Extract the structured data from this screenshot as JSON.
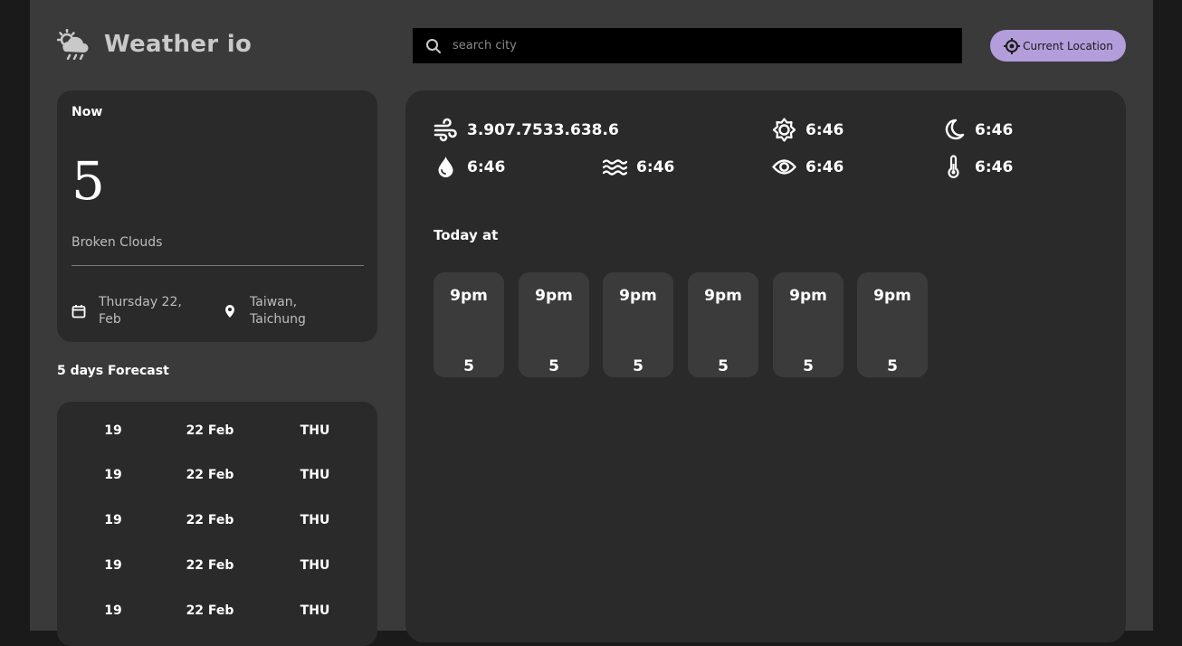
{
  "header": {
    "app_name": "Weather io",
    "logo_icon": "cloud-sun-rain-icon",
    "search_placeholder": "search city",
    "location_button": "Current Location"
  },
  "current": {
    "label": "Now",
    "temperature": "5",
    "description": "Broken Clouds",
    "date": "Thursday 22,\nFeb",
    "location": "Taiwan,\nTaichung"
  },
  "forecast": {
    "title": "5 days Forecast",
    "rows": [
      {
        "temp": "19",
        "date": "22 Feb",
        "day": "THU"
      },
      {
        "temp": "19",
        "date": "22 Feb",
        "day": "THU"
      },
      {
        "temp": "19",
        "date": "22 Feb",
        "day": "THU"
      },
      {
        "temp": "19",
        "date": "22 Feb",
        "day": "THU"
      },
      {
        "temp": "19",
        "date": "22 Feb",
        "day": "THU"
      }
    ]
  },
  "highlights": {
    "wind": "3.907.7533.638.6",
    "sunrise": "6:46",
    "sunset": "6:46",
    "humidity": "6:46",
    "pressure": "6:46",
    "visibility": "6:46",
    "feels_like": "6:46"
  },
  "today": {
    "title": "Today at",
    "hours": [
      {
        "time": "9pm",
        "temp": "5"
      },
      {
        "time": "9pm",
        "temp": "5"
      },
      {
        "time": "9pm",
        "temp": "5"
      },
      {
        "time": "9pm",
        "temp": "5"
      },
      {
        "time": "9pm",
        "temp": "5"
      },
      {
        "time": "9pm",
        "temp": "5"
      }
    ]
  },
  "colors": {
    "page_bg": "#1a1a1a",
    "app_bg": "#3a3a3a",
    "card_bg": "#2a2a2a",
    "accent": "#b39ddb"
  }
}
